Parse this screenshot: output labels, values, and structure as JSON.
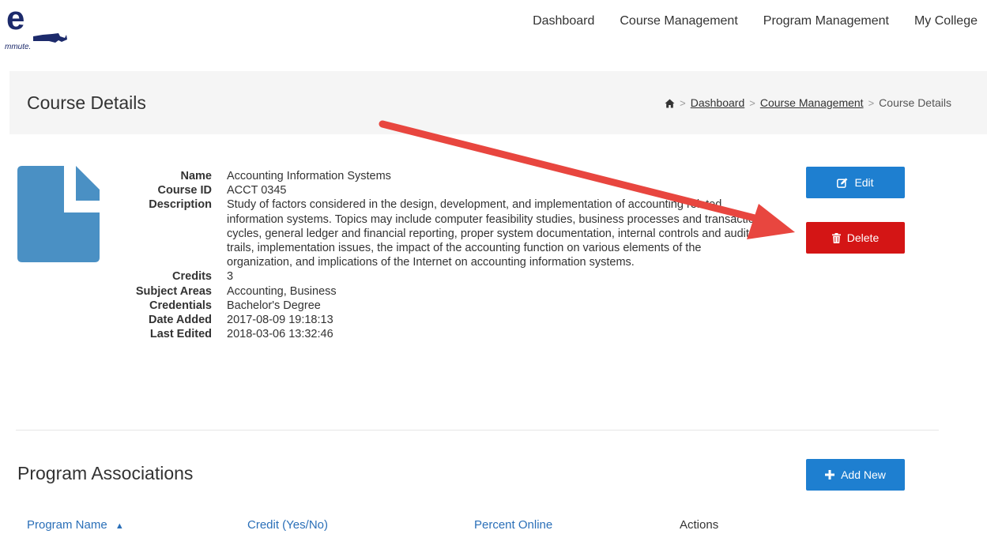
{
  "logo": {
    "letter": "e",
    "tagline": "mmute."
  },
  "nav": {
    "items": [
      "Dashboard",
      "Course Management",
      "Program Management",
      "My College"
    ]
  },
  "header": {
    "title": "Course Details",
    "breadcrumb": {
      "home_icon": "home-icon",
      "items": [
        "Dashboard",
        "Course Management"
      ],
      "current": "Course Details"
    }
  },
  "course": {
    "fields": [
      {
        "label": "Name",
        "value": "Accounting Information Systems"
      },
      {
        "label": "Course ID",
        "value": "ACCT 0345"
      },
      {
        "label": "Description",
        "value": "Study of factors considered in the design, development, and implementation of accounting related information systems. Topics may include computer feasibility studies, business processes and transaction cycles, general ledger and financial reporting, proper system documentation, internal controls and audit trails, implementation issues, the impact of the accounting function on various elements of the organization, and implications of the Internet on accounting information systems."
      },
      {
        "label": "Credits",
        "value": "3"
      },
      {
        "label": "Subject Areas",
        "value": "Accounting, Business"
      },
      {
        "label": "Credentials",
        "value": "Bachelor's Degree"
      },
      {
        "label": "Date Added",
        "value": "2017-08-09 19:18:13"
      },
      {
        "label": "Last Edited",
        "value": "2018-03-06 13:32:46"
      }
    ]
  },
  "actions": {
    "edit_label": "Edit",
    "delete_label": "Delete",
    "add_new_label": "Add New"
  },
  "program_associations": {
    "title": "Program Associations",
    "columns": [
      "Program Name",
      "Credit (Yes/No)",
      "Percent Online",
      "Actions"
    ]
  },
  "colors": {
    "primary": "#1e7fd0",
    "danger": "#d41515",
    "annotation_arrow": "#e8463f",
    "file_icon": "#4a90c4"
  }
}
